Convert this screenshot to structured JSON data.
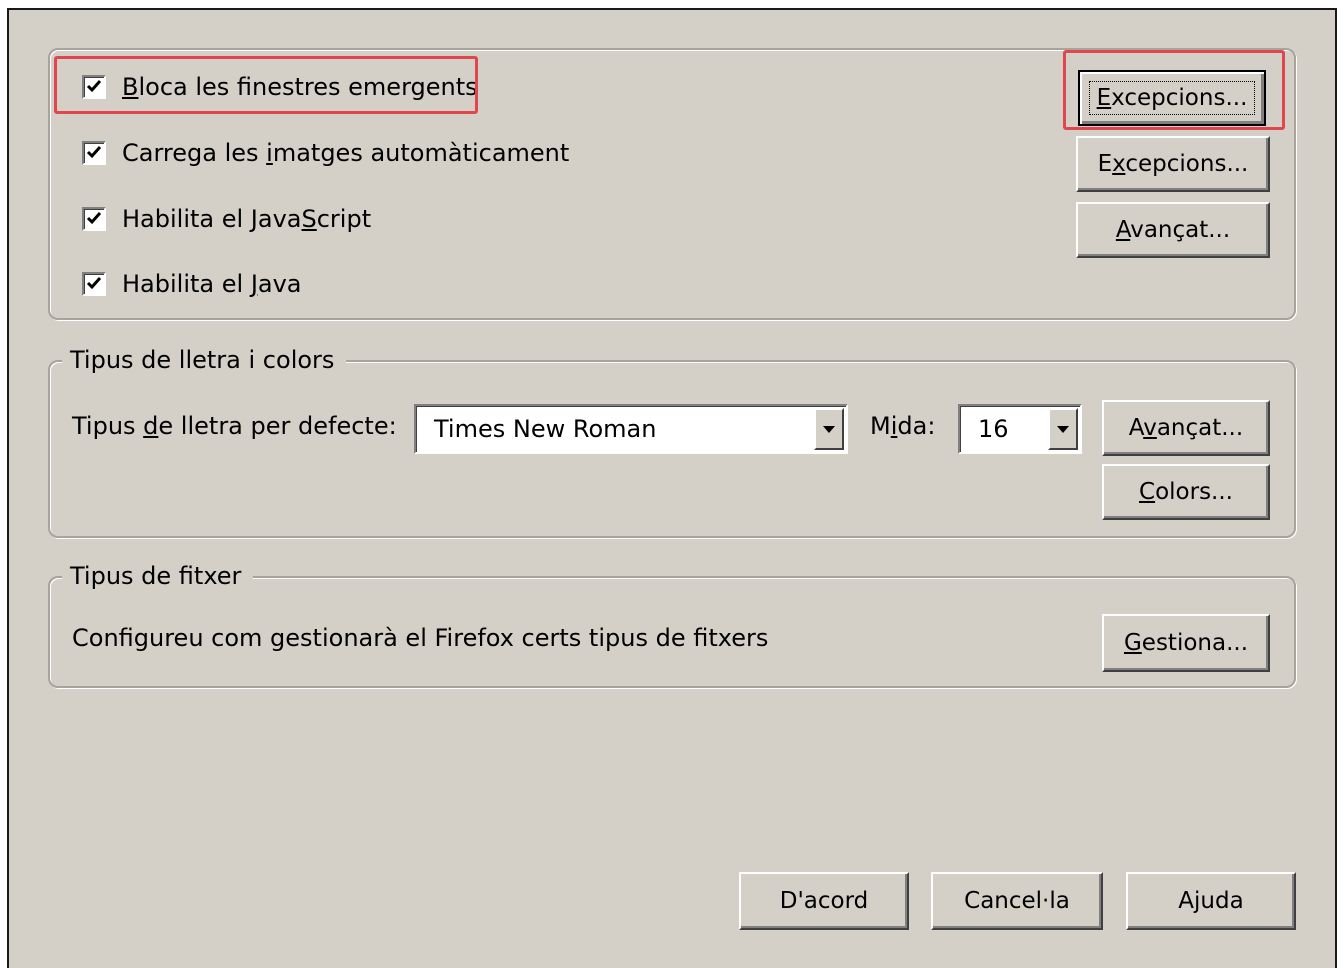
{
  "content_group": {
    "checkboxes": [
      {
        "label_pre": "",
        "mnemonic": "B",
        "label_post": "loca les finestres emergents",
        "checked": true
      },
      {
        "label_pre": "Carrega les ",
        "mnemonic": "i",
        "label_post": "matges automàticament",
        "checked": true
      },
      {
        "label_pre": "Habilita el Java",
        "mnemonic": "S",
        "label_post": "cript",
        "checked": true
      },
      {
        "label_pre": "Habilita el ",
        "mnemonic": "J",
        "label_post": "ava",
        "checked": true
      }
    ],
    "buttons": [
      {
        "pre": "",
        "mnemonic": "E",
        "post": "xcepcions..."
      },
      {
        "pre": "E",
        "mnemonic": "x",
        "post": "cepcions..."
      },
      {
        "pre": "",
        "mnemonic": "A",
        "post": "vançat..."
      }
    ]
  },
  "fonts_group": {
    "legend": "Tipus de lletra i colors",
    "default_font_label": {
      "pre": "Tipus ",
      "mnemonic": "d",
      "post": "e lletra per defecte:"
    },
    "default_font_value": "Times New Roman",
    "size_label": {
      "pre": "M",
      "mnemonic": "i",
      "post": "da:"
    },
    "size_value": "16",
    "advanced_button": {
      "pre": "A",
      "mnemonic": "v",
      "post": "ançat..."
    },
    "colors_button": {
      "pre": "",
      "mnemonic": "C",
      "post": "olors..."
    }
  },
  "filetypes_group": {
    "legend": "Tipus de fitxer",
    "description": "Configureu com gestionarà el Firefox certs tipus de fitxers",
    "manage_button": {
      "pre": "",
      "mnemonic": "G",
      "post": "estiona..."
    }
  },
  "footer": {
    "ok": "D'acord",
    "cancel": "Cancel·la",
    "help": "Ajuda"
  },
  "colors": {
    "dialog_bg": "#d4d0c8",
    "highlight": "#e0464e"
  }
}
